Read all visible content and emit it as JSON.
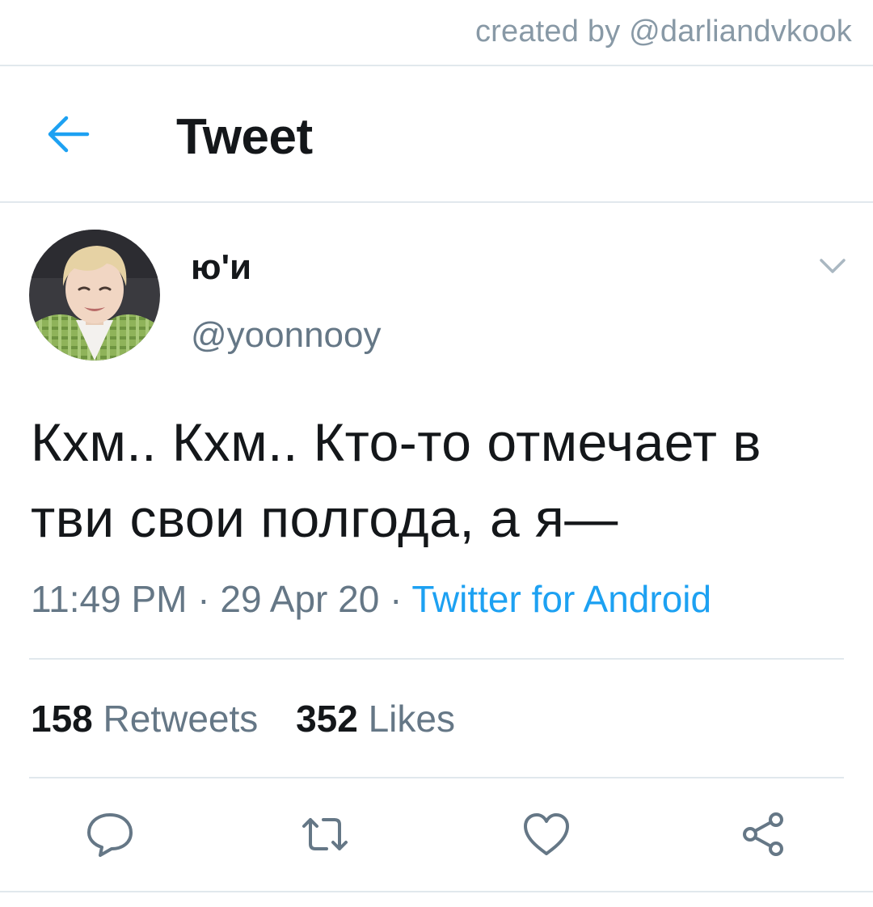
{
  "watermark": "created by @darliandvkook",
  "header": {
    "title": "Tweet"
  },
  "tweet": {
    "author": {
      "display_name": "ю'и",
      "handle": "@yoonnooy"
    },
    "text": "Кхм.. Кхм.. Кто-то отмечает в тви свои полгода, а я—",
    "time": "11:49 PM",
    "date": "29 Apr 20",
    "separator": " · ",
    "source": "Twitter for Android",
    "stats": {
      "retweets_count": "158",
      "retweets_label": "Retweets",
      "likes_count": "352",
      "likes_label": "Likes"
    }
  },
  "icons": {
    "back": "arrow-left-icon",
    "caret": "chevron-down-icon",
    "reply": "reply-icon",
    "retweet": "retweet-icon",
    "like": "heart-icon",
    "share": "share-icon"
  },
  "colors": {
    "accent": "#1da1f2",
    "text_primary": "#14171a",
    "text_secondary": "#657786",
    "divider": "#e1e8ed"
  }
}
